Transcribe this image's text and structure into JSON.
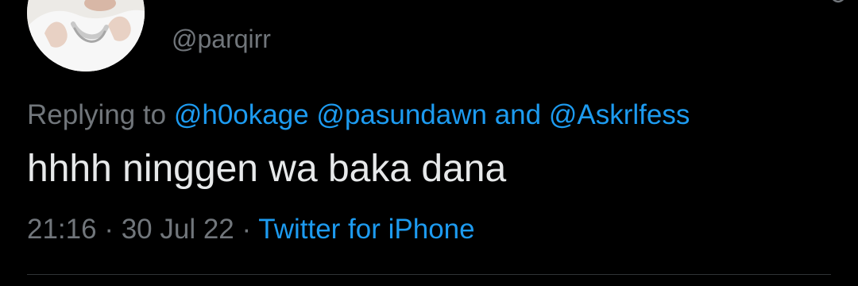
{
  "tweet": {
    "handle": "@parqirr",
    "reply": {
      "prefix": "Replying to",
      "mention_1": "@h0okage",
      "mention_2": "@pasundawn",
      "conjunction": "and",
      "mention_3": "@Askrlfess"
    },
    "text": "hhhh ninggen wa baka dana",
    "time": "21:16",
    "separator": "·",
    "date": "30 Jul 22",
    "source": "Twitter for iPhone"
  },
  "colors": {
    "background": "#000000",
    "text": "#E7E9EA",
    "secondary": "#71767B",
    "link": "#1D9BF0",
    "divider": "#2F3336"
  },
  "icons": {
    "avatar": "profile-photo",
    "corner": "more-options-icon"
  }
}
